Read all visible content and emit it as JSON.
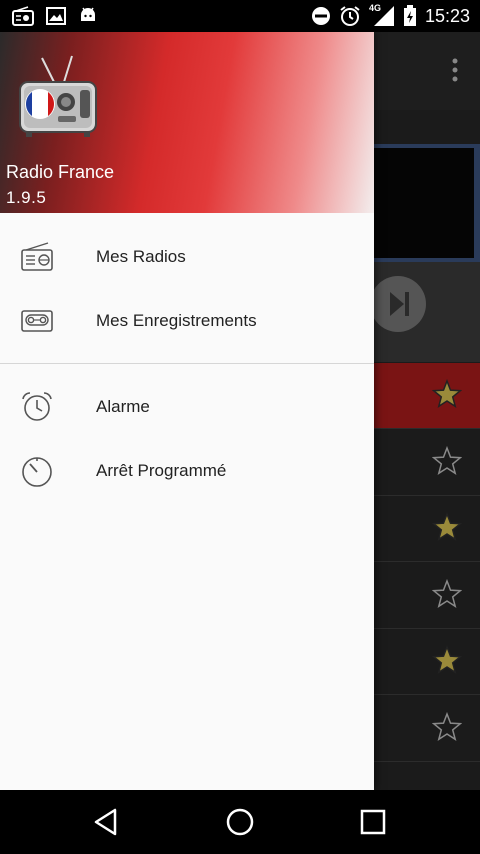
{
  "status_bar": {
    "time": "15:23",
    "network": "4G",
    "left_icons": [
      "radio-icon",
      "image-icon",
      "android-icon"
    ],
    "right_icons": [
      "do-not-disturb-icon",
      "alarm-icon",
      "signal-icon",
      "battery-charging-icon"
    ]
  },
  "drawer": {
    "app_name": "Radio France",
    "version": "1.9.5",
    "items": [
      {
        "label": "Mes Radios",
        "icon": "radio-icon"
      },
      {
        "label": "Mes Enregistrements",
        "icon": "cassette-icon"
      },
      {
        "label": "Alarme",
        "icon": "alarm-clock-icon"
      },
      {
        "label": "Arrêt Programmé",
        "icon": "timer-icon"
      }
    ]
  },
  "background_list": {
    "stars": [
      "filled",
      "empty",
      "filled",
      "empty",
      "filled",
      "empty"
    ],
    "active_row": 0
  },
  "colors": {
    "accent_red": "#d42a2a",
    "star_filled": "#9a8a3a",
    "star_empty": "#8a8a8a"
  },
  "nav_bar": {
    "buttons": [
      "back-icon",
      "home-icon",
      "recents-icon"
    ]
  }
}
